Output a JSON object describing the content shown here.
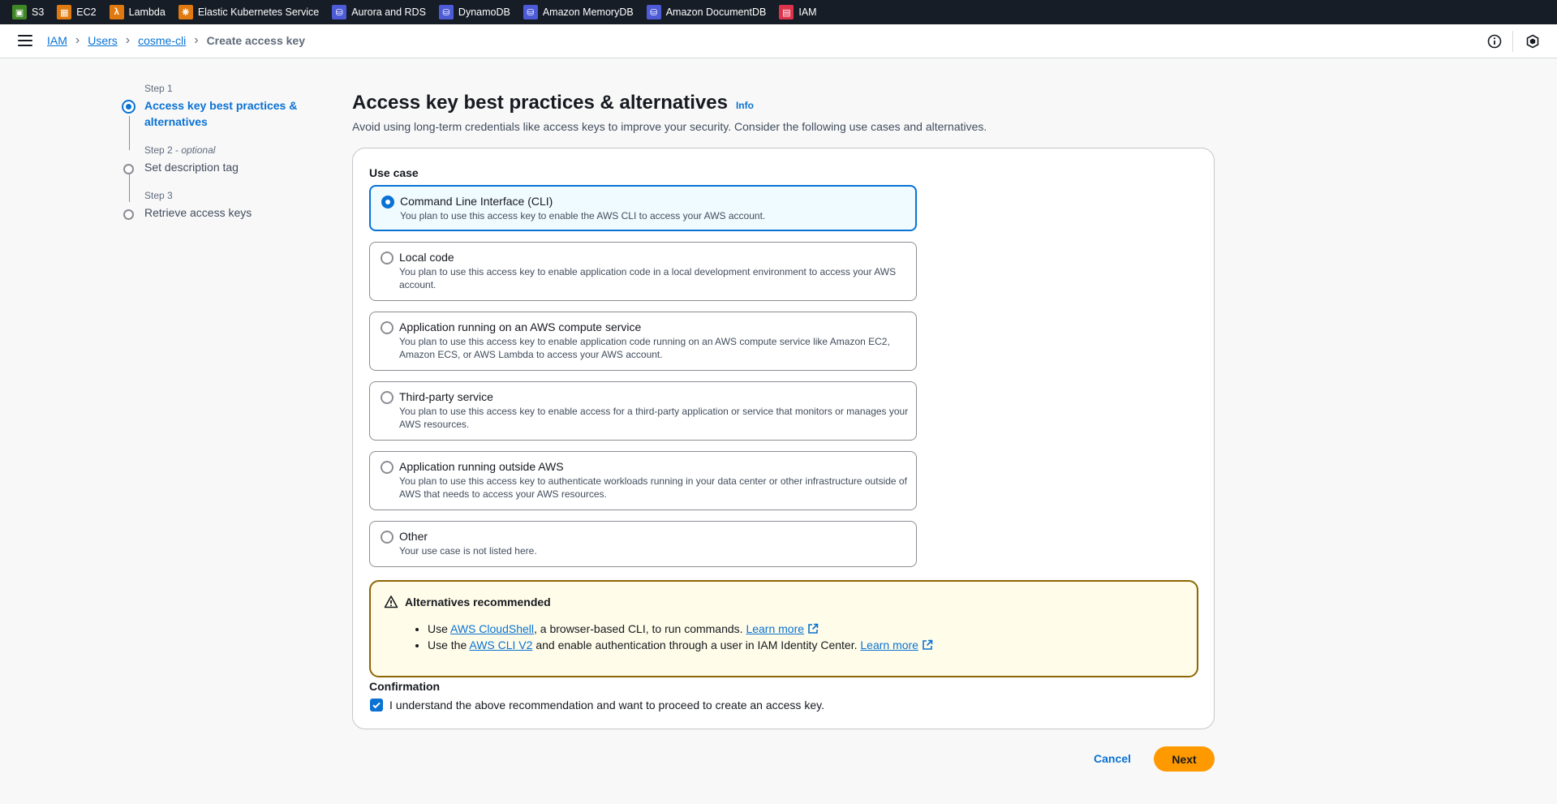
{
  "favorites": [
    {
      "label": "S3",
      "icon": "s3-icon",
      "color": "#3f8624",
      "glyph": "▣"
    },
    {
      "label": "EC2",
      "icon": "ec2-icon",
      "color": "#e07a10",
      "glyph": "▦"
    },
    {
      "label": "Lambda",
      "icon": "lambda-icon",
      "color": "#e07a10",
      "glyph": "λ"
    },
    {
      "label": "Elastic Kubernetes Service",
      "icon": "eks-icon",
      "color": "#e07a10",
      "glyph": "⎈"
    },
    {
      "label": "Aurora and RDS",
      "icon": "rds-icon",
      "color": "#4d5bd6",
      "glyph": "⛁"
    },
    {
      "label": "DynamoDB",
      "icon": "dynamodb-icon",
      "color": "#4d5bd6",
      "glyph": "⛁"
    },
    {
      "label": "Amazon MemoryDB",
      "icon": "memorydb-icon",
      "color": "#4d5bd6",
      "glyph": "⛁"
    },
    {
      "label": "Amazon DocumentDB",
      "icon": "documentdb-icon",
      "color": "#4d5bd6",
      "glyph": "⛁"
    },
    {
      "label": "IAM",
      "icon": "iam-icon",
      "color": "#dd344c",
      "glyph": "▤"
    }
  ],
  "breadcrumb": {
    "iam": "IAM",
    "users": "Users",
    "user": "cosme-cli",
    "current": "Create access key"
  },
  "steps": [
    {
      "number": "Step 1",
      "optional": "",
      "title": "Access key best practices & alternatives",
      "active": true
    },
    {
      "number": "Step 2",
      "optional": "optional",
      "title": "Set description tag",
      "active": false
    },
    {
      "number": "Step 3",
      "optional": "",
      "title": "Retrieve access keys",
      "active": false
    }
  ],
  "page": {
    "title": "Access key best practices & alternatives",
    "info": "Info",
    "subtitle": "Avoid using long-term credentials like access keys to improve your security. Consider the following use cases and alternatives."
  },
  "use_case": {
    "label": "Use case",
    "options": [
      {
        "title": "Command Line Interface (CLI)",
        "desc": "You plan to use this access key to enable the AWS CLI to access your AWS account.",
        "selected": true
      },
      {
        "title": "Local code",
        "desc": "You plan to use this access key to enable application code in a local development environment to access your AWS account.",
        "selected": false
      },
      {
        "title": "Application running on an AWS compute service",
        "desc": "You plan to use this access key to enable application code running on an AWS compute service like Amazon EC2, Amazon ECS, or AWS Lambda to access your AWS account.",
        "selected": false
      },
      {
        "title": "Third-party service",
        "desc": "You plan to use this access key to enable access for a third-party application or service that monitors or manages your AWS resources.",
        "selected": false
      },
      {
        "title": "Application running outside AWS",
        "desc": "You plan to use this access key to authenticate workloads running in your data center or other infrastructure outside of AWS that needs to access your AWS resources.",
        "selected": false
      },
      {
        "title": "Other",
        "desc": "Your use case is not listed here.",
        "selected": false
      }
    ]
  },
  "alert": {
    "title": "Alternatives recommended",
    "item1": {
      "pre": "Use ",
      "link": "AWS CloudShell",
      "post": ", a browser-based CLI, to run commands. ",
      "learn": "Learn more"
    },
    "item2": {
      "pre": "Use the ",
      "link": "AWS CLI V2",
      "post": " and enable authentication through a user in IAM Identity Center. ",
      "learn": "Learn more"
    }
  },
  "confirmation": {
    "label": "Confirmation",
    "text": "I understand the above recommendation and want to proceed to create an access key.",
    "checked": true
  },
  "buttons": {
    "cancel": "Cancel",
    "next": "Next"
  }
}
